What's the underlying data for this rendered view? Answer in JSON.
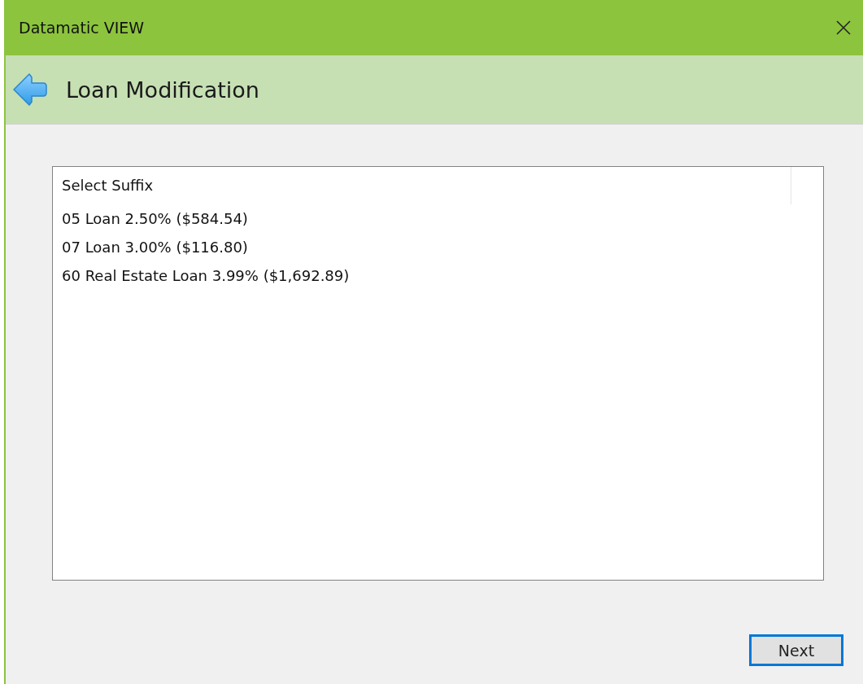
{
  "window": {
    "title": "Datamatic VIEW"
  },
  "header": {
    "title": "Loan Modification"
  },
  "list": {
    "column_header": "Select Suffix",
    "items": [
      {
        "label": "05 Loan 2.50% ($584.54)",
        "selected": false
      },
      {
        "label": "07 Loan 3.00% ($116.80)",
        "selected": false
      },
      {
        "label": "60 Real Estate Loan 3.99% ($1,692.89)",
        "selected": false
      }
    ]
  },
  "buttons": [
    {
      "label": "Next",
      "focused": true
    }
  ]
}
